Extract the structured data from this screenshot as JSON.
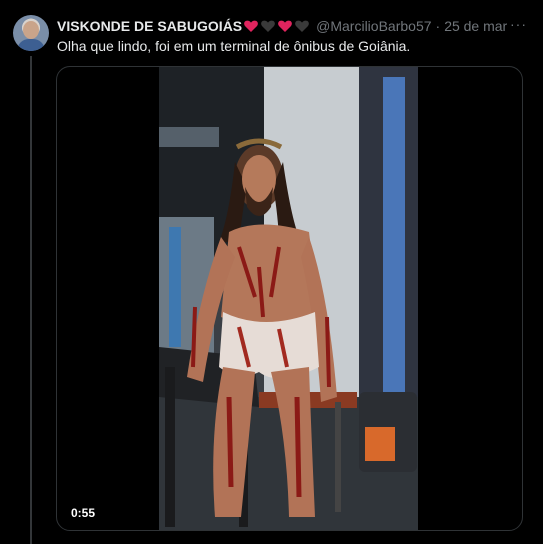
{
  "tweet": {
    "author_name": "VISKONDE DE SABUGOIÁS",
    "name_emojis": [
      "red-heart",
      "black-heart",
      "red-heart",
      "black-heart"
    ],
    "handle": "@MarcilioBarbo57",
    "separator": "·",
    "date": "25 de mar",
    "more_label": "···",
    "text": "Olha que lindo, foi em um terminal de ônibus de Goiânia."
  },
  "media": {
    "duration": "0:55"
  },
  "colors": {
    "background": "#000000",
    "text_primary": "#e7e9ea",
    "text_secondary": "#71767b",
    "border": "#2f3336",
    "heart_red": "#e0245e",
    "heart_black": "#3a3a3a"
  }
}
